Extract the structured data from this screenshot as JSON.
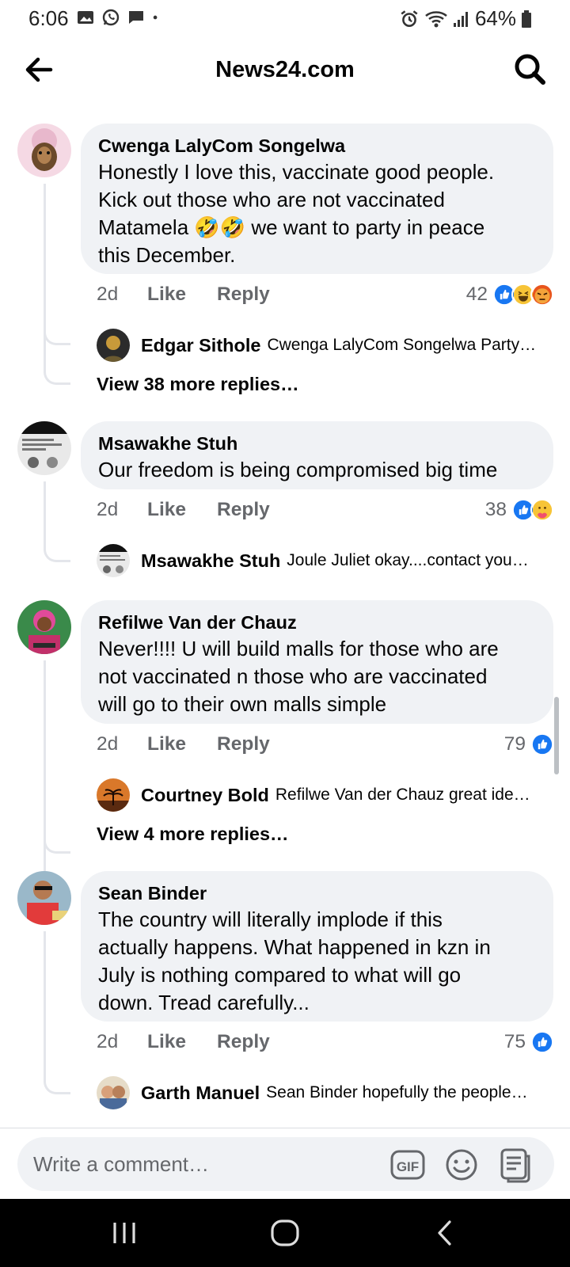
{
  "status": {
    "time": "6:06",
    "battery": "64%"
  },
  "header": {
    "title": "News24.com"
  },
  "comments": [
    {
      "author": "Cwenga LalyCom Songelwa",
      "text_lines": [
        "Honestly I love this, vaccinate good people.",
        "Kick out those who are not vaccinated",
        "Matamela 🤣🤣 we want to party in peace",
        "this December."
      ],
      "time": "2d",
      "like": "Like",
      "reply": "Reply",
      "reaction_count": "42",
      "reactions": [
        "like-icon",
        "haha-icon",
        "angry-icon"
      ],
      "reply_preview": {
        "author": "Edgar Sithole",
        "text": "Cwenga LalyCom Songelwa Party…"
      },
      "view_more": "View 38 more replies…"
    },
    {
      "author": "Msawakhe Stuh",
      "text_lines": [
        "Our freedom is being compromised big time"
      ],
      "time": "2d",
      "like": "Like",
      "reply": "Reply",
      "reaction_count": "38",
      "reactions": [
        "like-icon",
        "care-icon"
      ],
      "reply_preview": {
        "author": "Msawakhe Stuh",
        "text": "Joule Juliet okay....contact you…"
      },
      "view_more": ""
    },
    {
      "author": "Refilwe Van der Chauz",
      "text_lines": [
        "Never!!!! U will build malls for those who are",
        "not vaccinated n those who are vaccinated",
        "will go to their own malls simple"
      ],
      "time": "2d",
      "like": "Like",
      "reply": "Reply",
      "reaction_count": "79",
      "reactions": [
        "like-icon"
      ],
      "reply_preview": {
        "author": "Courtney Bold",
        "text": "Refilwe Van der Chauz great ide…"
      },
      "view_more": "View 4 more replies…"
    },
    {
      "author": "Sean Binder",
      "text_lines": [
        "The country will literally implode if this",
        "actually happens. What happened in kzn in",
        "July is nothing compared to what will go",
        "down. Tread carefully..."
      ],
      "time": "2d",
      "like": "Like",
      "reply": "Reply",
      "reaction_count": "75",
      "reactions": [
        "like-icon"
      ],
      "reply_preview": {
        "author": "Garth Manuel",
        "text": "Sean Binder hopefully the people…"
      },
      "view_more": ""
    }
  ],
  "composer": {
    "placeholder": "Write a comment…",
    "gif_label": "GIF"
  },
  "colors": {
    "like_blue": "#1877f2",
    "bubble_bg": "#f0f2f5",
    "meta_gray": "#65676b"
  }
}
